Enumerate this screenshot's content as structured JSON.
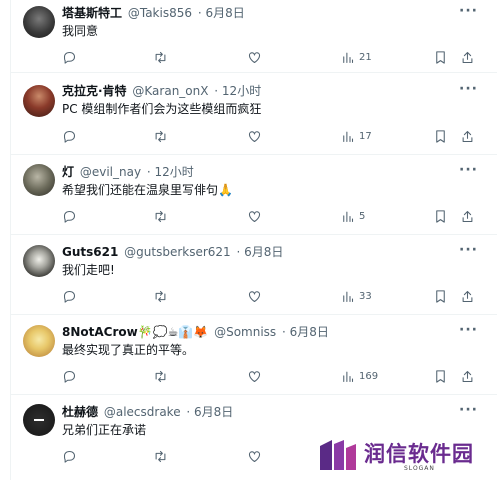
{
  "colors": {
    "text": "#0f1419",
    "muted": "#536471",
    "border": "#eff3f4",
    "watermark": "#6a2b8f"
  },
  "icons": {
    "more": "more-dots-icon",
    "reply": "reply-icon",
    "retweet": "retweet-icon",
    "like": "heart-icon",
    "views": "bar-chart-icon",
    "bookmark": "bookmark-icon",
    "share": "share-icon"
  },
  "tweets": [
    {
      "name": "塔基斯特工",
      "handle": "@Takis856",
      "time": "· 6月8日",
      "text": "我同意",
      "views": "21",
      "more": "···"
    },
    {
      "name": "克拉克·肯特",
      "handle": "@Karan_onX",
      "time": "· 12小时",
      "text": "PC 模组制作者们会为这些模组而疯狂",
      "views": "17",
      "more": "···"
    },
    {
      "name": "灯",
      "handle": "@evil_nay",
      "time": "· 12小时",
      "text": "希望我们还能在温泉里写俳句🙏",
      "views": "5",
      "more": "···"
    },
    {
      "name": "Guts621",
      "handle": "@gutsberkser621",
      "time": "· 6月8日",
      "text": "我们走吧!",
      "views": "33",
      "more": "···"
    },
    {
      "name": "8NotACrow🎋💭☕👔🦊",
      "handle": "@Somniss",
      "time": "· 6月8日",
      "text": "最终实现了真正的平等。",
      "views": "169",
      "more": "···"
    },
    {
      "name": "杜赫德",
      "handle": "@alecsdrake",
      "time": "· 6月8日",
      "text": "兄弟们正在承诺",
      "views": "",
      "more": "···"
    }
  ],
  "watermark": {
    "brand": "润信软件园",
    "slogan": "SLOGAN"
  }
}
